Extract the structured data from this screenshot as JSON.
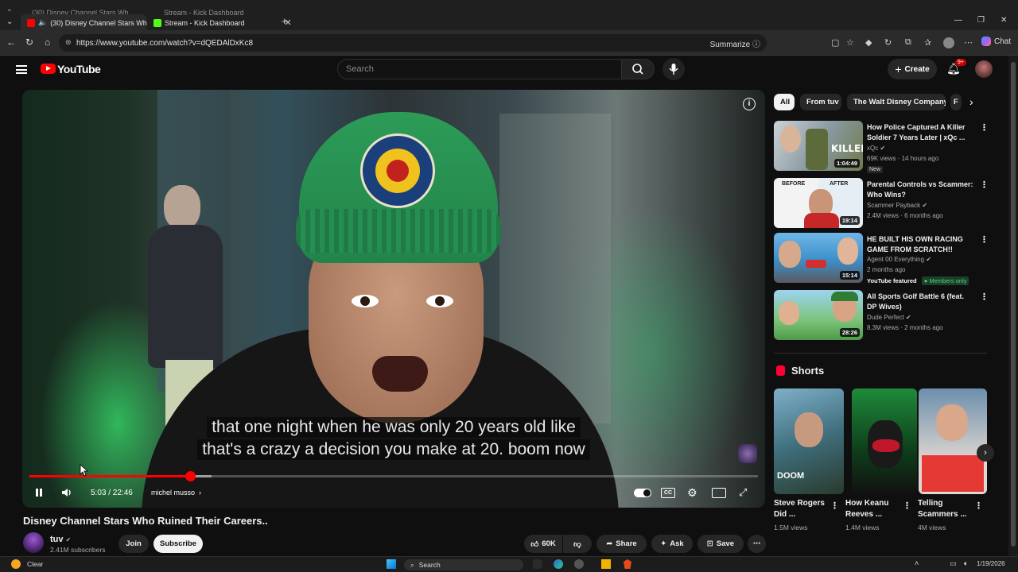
{
  "browser": {
    "tabs": [
      {
        "label": "(30) Disney Channel Stars Wh",
        "favicon_color": "#ff0000"
      },
      {
        "label": "Stream - Kick Dashboard",
        "favicon_color": "#53fc18"
      }
    ],
    "ghost_tabs": [
      {
        "label": "(30) Disney Channel Stars Wh"
      },
      {
        "label": "Stream - Kick Dashboard"
      }
    ],
    "url": "https://www.youtube.com/watch?v=dQEDAlDxKc8",
    "summarize_label": "Summarize",
    "chat_label": "Chat"
  },
  "youtube": {
    "logo_text": "YouTube",
    "search_placeholder": "Search",
    "create_label": "Create",
    "notification_count": "9+"
  },
  "player": {
    "caption_lines": [
      "that one night when he was only 20 years old like",
      "that's a crazy a decision you make at 20. boom now"
    ],
    "time_current": "5:03",
    "time_total": "22:46",
    "time_display": "5:03 / 22:46",
    "chapter": "michel musso",
    "progress_fraction": 0.22,
    "buffered_fraction": 0.25
  },
  "video": {
    "title": "Disney Channel Stars Who Ruined Their Careers..",
    "channel": "tuv",
    "subscribers": "2.41M subscribers",
    "join_label": "Join",
    "subscribe_label": "Subscribe",
    "likes": "60K",
    "share_label": "Share",
    "ask_label": "Ask",
    "save_label": "Save"
  },
  "chips": [
    "All",
    "From tuv",
    "The Walt Disney Company",
    "F"
  ],
  "recommendations": [
    {
      "title": "How Police Captured A Killer Soldier 7 Years Later | xQc ...",
      "channel": "xQc",
      "meta": "69K views · 14 hours ago",
      "duration": "1:04:49",
      "badge": "New"
    },
    {
      "title": "Parental Controls vs Scammer: Who Wins?",
      "channel": "Scammer Payback",
      "meta": "2.4M views · 6 months ago",
      "duration": "19:14"
    },
    {
      "title": "HE BUILT HIS OWN RACING GAME FROM SCRATCH!!",
      "channel": "Agent 00 Everything",
      "meta": "2 months ago",
      "duration": "15:14",
      "featured": "YouTube featured",
      "members": "Members only"
    },
    {
      "title": "All Sports Golf Battle 6 (feat. DP Wives)",
      "channel": "Dude Perfect",
      "meta": "8.3M views · 2 months ago",
      "duration": "28:26"
    }
  ],
  "shorts": {
    "heading": "Shorts",
    "items": [
      {
        "title": "Steve Rogers Did ...",
        "views": "1.5M views"
      },
      {
        "title": "How Keanu Reeves ...",
        "views": "1.4M views"
      },
      {
        "title": "Telling Scammers ...",
        "views": "4M views"
      }
    ]
  },
  "taskbar": {
    "weather": "Clear",
    "search_label": "Search",
    "date": "1/19/2026"
  }
}
